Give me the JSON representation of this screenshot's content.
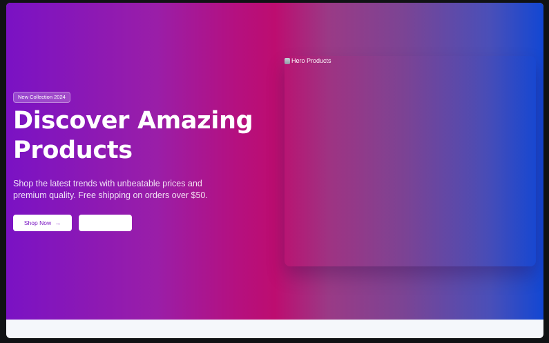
{
  "hero": {
    "badge": "New Collection 2024",
    "title": "Discover Amazing Products",
    "subtitle": "Shop the latest trends with unbeatable prices and premium quality. Free shipping on orders over $50.",
    "primary_button": {
      "label": "Shop Now",
      "icon": "arrow-right-icon",
      "icon_glyph": "→"
    },
    "secondary_button": {
      "label": ""
    },
    "image": {
      "alt": "Hero Products",
      "icon": "broken-image-icon"
    }
  },
  "colors": {
    "gradient_start": "#7a12c4",
    "gradient_middle": "#bd0d70",
    "gradient_end": "#1247d3",
    "primary_button_text": "#7a16c2",
    "footer_strip": "#f5f7fb"
  }
}
